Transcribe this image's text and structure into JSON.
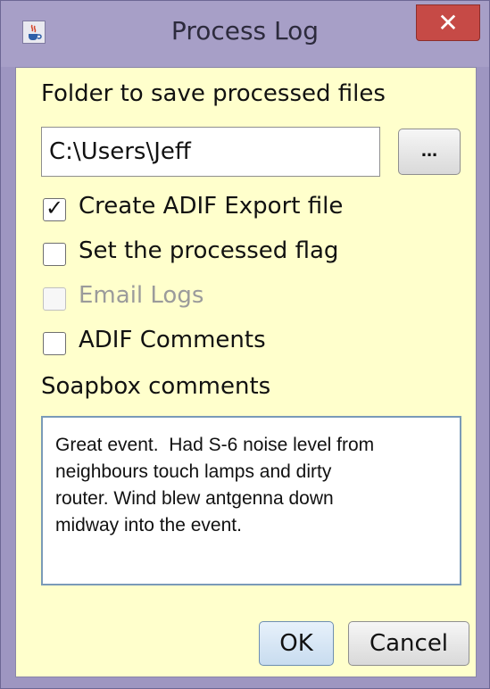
{
  "window": {
    "title": "Process Log",
    "close_label": "✕"
  },
  "form": {
    "folder_label": "Folder to save processed files",
    "folder_value": "C:\\Users\\Jeff",
    "browse_label": "...",
    "options": [
      {
        "label": "Create ADIF Export file",
        "checked": true,
        "enabled": true
      },
      {
        "label": "Set the processed flag",
        "checked": false,
        "enabled": true
      },
      {
        "label": "Email Logs",
        "checked": false,
        "enabled": false
      },
      {
        "label": "ADIF Comments",
        "checked": false,
        "enabled": true
      }
    ],
    "comments_label": "Soapbox comments",
    "comments_value": "Great event.  Had S-6 noise level from\nneighbours touch lamps and dirty\nrouter. Wind blew antgenna down\nmidway into the event."
  },
  "buttons": {
    "ok_label": "OK",
    "cancel_label": "Cancel"
  },
  "icons": {
    "app": "java-app-icon",
    "check": "checkmark-icon"
  }
}
